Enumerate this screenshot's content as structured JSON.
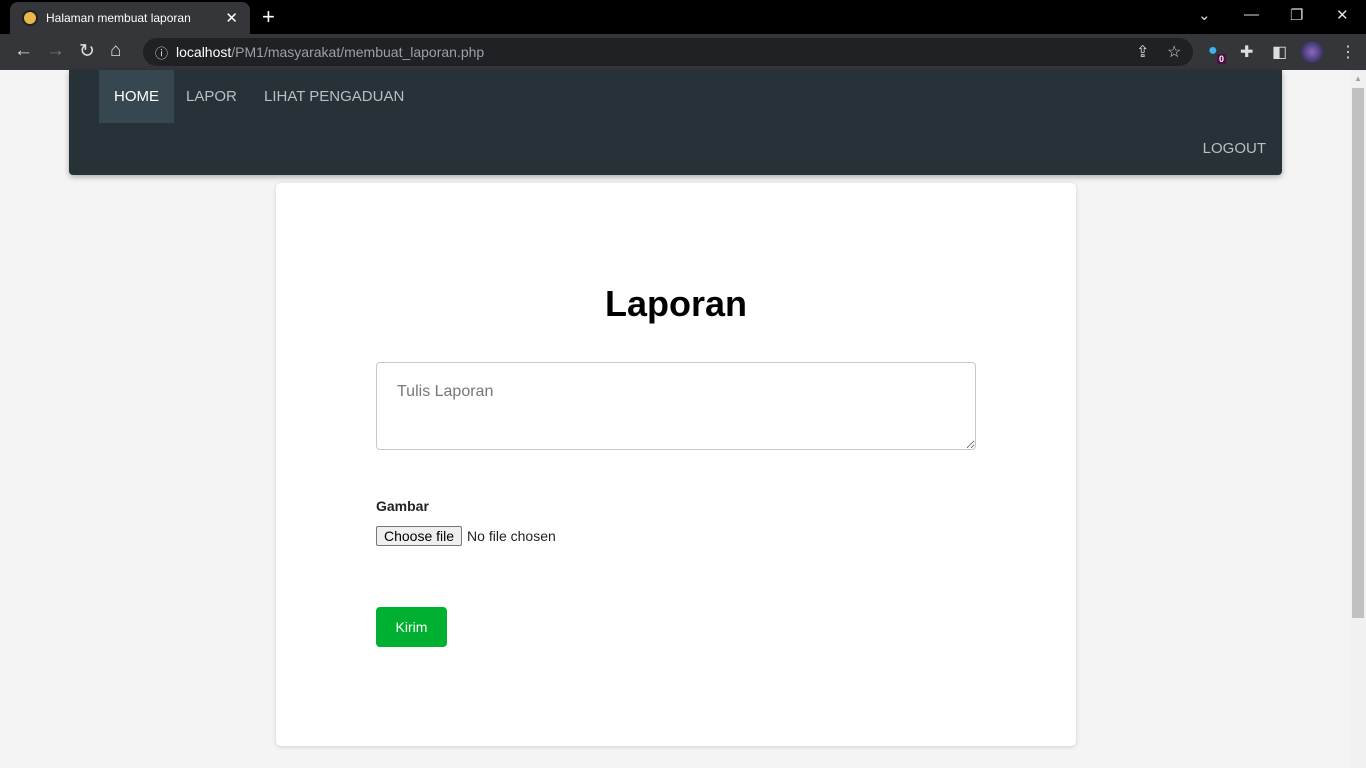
{
  "browser": {
    "tab_title": "Halaman membuat laporan",
    "url_host": "localhost",
    "url_path": "/PM1/masyarakat/membuat_laporan.php",
    "extension_badge": "0"
  },
  "nav": {
    "items": [
      {
        "label": "HOME"
      },
      {
        "label": "LAPOR"
      },
      {
        "label": "LIHAT PENGADUAN"
      }
    ],
    "logout": "LOGOUT"
  },
  "form": {
    "title": "Laporan",
    "report_placeholder": "Tulis Laporan",
    "image_label": "Gambar",
    "choose_file": "Choose file",
    "no_file": "No file chosen",
    "submit": "Kirim"
  },
  "colors": {
    "navbar": "#263238",
    "nav_active": "#37474f",
    "submit": "#00b030"
  }
}
